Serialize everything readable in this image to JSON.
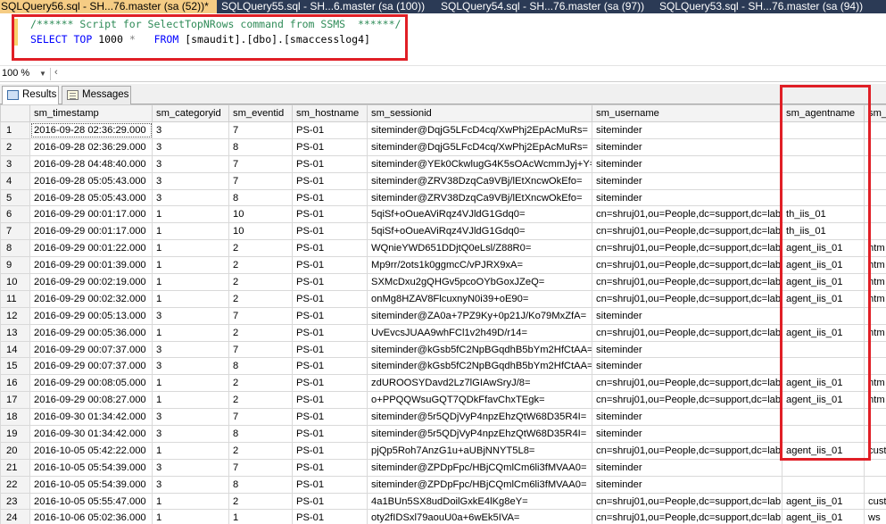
{
  "tabs": [
    {
      "label": "SQLQuery56.sql - SH...76.master (sa (52))*",
      "active": true
    },
    {
      "label": "SQLQuery55.sql - SH...6.master (sa (100))",
      "active": false
    },
    {
      "label": "SQLQuery54.sql - SH...76.master (sa (97))",
      "active": false
    },
    {
      "label": "SQLQuery53.sql - SH...76.master (sa (94))",
      "active": false
    }
  ],
  "editor": {
    "comment": "/****** Script for SelectTopNRows command from SSMS  ******/",
    "kw_select": "SELECT",
    "kw_top": "TOP",
    "top_n": "1000",
    "star": "*",
    "kw_from": "FROM",
    "table": "[smaudit].[dbo].[smaccesslog4]"
  },
  "zoom": {
    "value": "100 %"
  },
  "result_tabs": {
    "results": "Results",
    "messages": "Messages"
  },
  "grid": {
    "columns": [
      "sm_timestamp",
      "sm_categoryid",
      "sm_eventid",
      "sm_hostname",
      "sm_sessionid",
      "sm_username",
      "sm_agentname",
      "sm_r"
    ],
    "rows": [
      [
        "1",
        "2016-09-28 02:36:29.000",
        "3",
        "7",
        "PS-01",
        "siteminder@DqjG5LFcD4cq/XwPhj2EpAcMuRs=",
        "siteminder",
        "",
        ""
      ],
      [
        "2",
        "2016-09-28 02:36:29.000",
        "3",
        "8",
        "PS-01",
        "siteminder@DqjG5LFcD4cq/XwPhj2EpAcMuRs=",
        "siteminder",
        "",
        ""
      ],
      [
        "3",
        "2016-09-28 04:48:40.000",
        "3",
        "7",
        "PS-01",
        "siteminder@YEk0CkwlugG4K5sOAcWcmmJyj+Y=",
        "siteminder",
        "",
        ""
      ],
      [
        "4",
        "2016-09-28 05:05:43.000",
        "3",
        "7",
        "PS-01",
        "siteminder@ZRV38DzqCa9VBj/lEtXncwOkEfo=",
        "siteminder",
        "",
        ""
      ],
      [
        "5",
        "2016-09-28 05:05:43.000",
        "3",
        "8",
        "PS-01",
        "siteminder@ZRV38DzqCa9VBj/lEtXncwOkEfo=",
        "siteminder",
        "",
        ""
      ],
      [
        "6",
        "2016-09-29 00:01:17.000",
        "1",
        "10",
        "PS-01",
        "5qiSf+oOueAViRqz4VJldG1Gdq0=",
        "cn=shruj01,ou=People,dc=support,dc=lab",
        "th_iis_01",
        ""
      ],
      [
        "7",
        "2016-09-29 00:01:17.000",
        "1",
        "10",
        "PS-01",
        "5qiSf+oOueAViRqz4VJldG1Gdq0=",
        "cn=shruj01,ou=People,dc=support,dc=lab",
        "th_iis_01",
        ""
      ],
      [
        "8",
        "2016-09-29 00:01:22.000",
        "1",
        "2",
        "PS-01",
        "WQnieYWD651DDjtQ0eLsl/Z88R0=",
        "cn=shruj01,ou=People,dc=support,dc=lab",
        "agent_iis_01",
        "htm"
      ],
      [
        "9",
        "2016-09-29 00:01:39.000",
        "1",
        "2",
        "PS-01",
        "Mp9rr/2ots1k0ggmcC/vPJRX9xA=",
        "cn=shruj01,ou=People,dc=support,dc=lab",
        "agent_iis_01",
        "htm"
      ],
      [
        "10",
        "2016-09-29 00:02:19.000",
        "1",
        "2",
        "PS-01",
        "SXMcDxu2gQHGv5pcoOYbGoxJZeQ=",
        "cn=shruj01,ou=People,dc=support,dc=lab",
        "agent_iis_01",
        "htm"
      ],
      [
        "11",
        "2016-09-29 00:02:32.000",
        "1",
        "2",
        "PS-01",
        "onMg8HZAV8FlcuxnyN0i39+oE90=",
        "cn=shruj01,ou=People,dc=support,dc=lab",
        "agent_iis_01",
        "htm"
      ],
      [
        "12",
        "2016-09-29 00:05:13.000",
        "3",
        "7",
        "PS-01",
        "siteminder@ZA0a+7PZ9Ky+0p21J/Ko79MxZfA=",
        "siteminder",
        "",
        ""
      ],
      [
        "13",
        "2016-09-29 00:05:36.000",
        "1",
        "2",
        "PS-01",
        "UvEvcsJUAA9whFCl1v2h49D/r14=",
        "cn=shruj01,ou=People,dc=support,dc=lab",
        "agent_iis_01",
        "htm"
      ],
      [
        "14",
        "2016-09-29 00:07:37.000",
        "3",
        "7",
        "PS-01",
        "siteminder@kGsb5fC2NpBGqdhB5bYm2HfCtAA=",
        "siteminder",
        "",
        ""
      ],
      [
        "15",
        "2016-09-29 00:07:37.000",
        "3",
        "8",
        "PS-01",
        "siteminder@kGsb5fC2NpBGqdhB5bYm2HfCtAA=",
        "siteminder",
        "",
        ""
      ],
      [
        "16",
        "2016-09-29 00:08:05.000",
        "1",
        "2",
        "PS-01",
        "zdUROOSYDavd2Lz7lGIAwSryJ/8=",
        "cn=shruj01,ou=People,dc=support,dc=lab",
        "agent_iis_01",
        "htm"
      ],
      [
        "17",
        "2016-09-29 00:08:27.000",
        "1",
        "2",
        "PS-01",
        "o+PPQQWsuGQT7QDkFfavChxTEgk=",
        "cn=shruj01,ou=People,dc=support,dc=lab",
        "agent_iis_01",
        "htm"
      ],
      [
        "18",
        "2016-09-30 01:34:42.000",
        "3",
        "7",
        "PS-01",
        "siteminder@5r5QDjVyP4npzEhzQtW68D35R4I=",
        "siteminder",
        "",
        ""
      ],
      [
        "19",
        "2016-09-30 01:34:42.000",
        "3",
        "8",
        "PS-01",
        "siteminder@5r5QDjVyP4npzEhzQtW68D35R4I=",
        "siteminder",
        "",
        ""
      ],
      [
        "20",
        "2016-10-05 05:42:22.000",
        "1",
        "2",
        "PS-01",
        "pjQp5Roh7AnzG1u+aUBjNNYT5L8=",
        "cn=shruj01,ou=People,dc=support,dc=lab",
        "agent_iis_01",
        "cust"
      ],
      [
        "21",
        "2016-10-05 05:54:39.000",
        "3",
        "7",
        "PS-01",
        "siteminder@ZPDpFpc/HBjCQmlCm6li3fMVAA0=",
        "siteminder",
        "",
        ""
      ],
      [
        "22",
        "2016-10-05 05:54:39.000",
        "3",
        "8",
        "PS-01",
        "siteminder@ZPDpFpc/HBjCQmlCm6li3fMVAA0=",
        "siteminder",
        "",
        ""
      ],
      [
        "23",
        "2016-10-05 05:55:47.000",
        "1",
        "2",
        "PS-01",
        "4a1BUn5SX8udDoilGxkE4lKg8eY=",
        "cn=shruj01,ou=People,dc=support,dc=lab",
        "agent_iis_01",
        "cust"
      ],
      [
        "24",
        "2016-10-06 05:02:36.000",
        "1",
        "1",
        "PS-01",
        "oty2fIDSxl79aouU0a+6wEk5IVA=",
        "cn=shruj01,ou=People,dc=support,dc=lab",
        "agent_iis_01",
        "ws"
      ]
    ]
  }
}
